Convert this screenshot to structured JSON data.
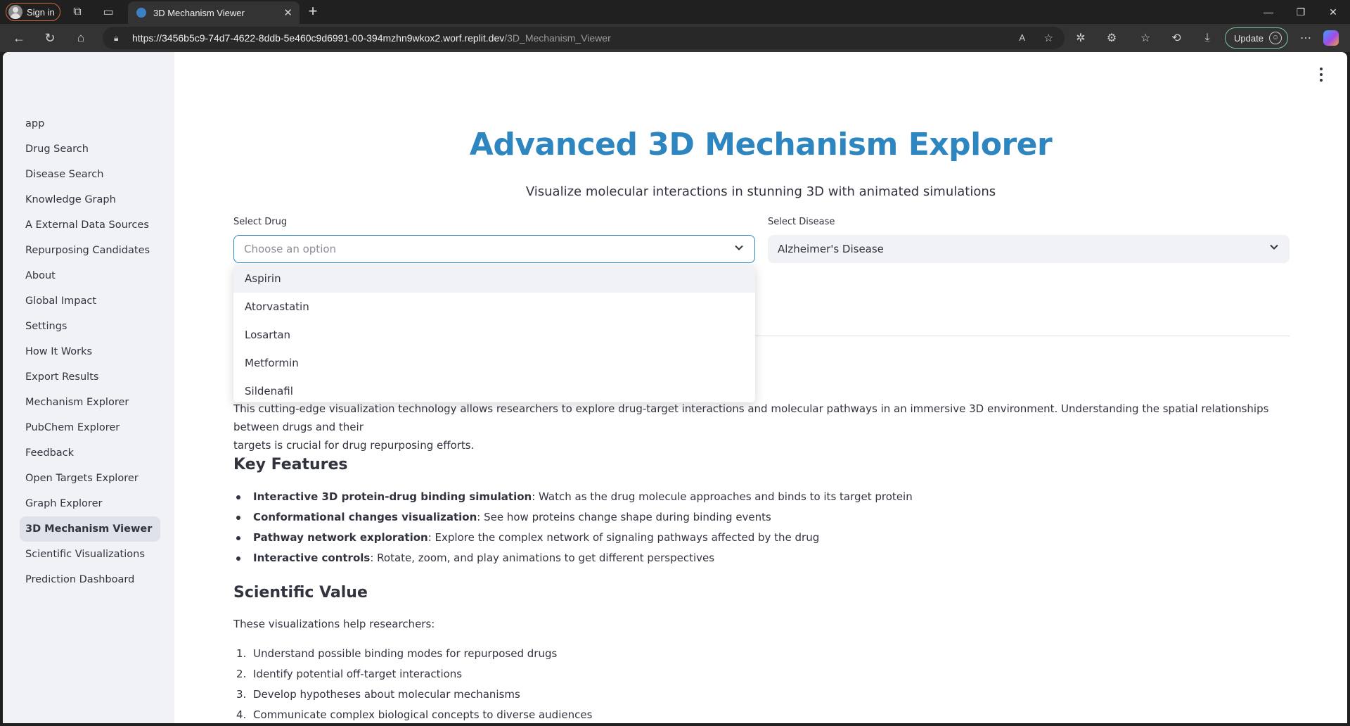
{
  "browser": {
    "signin_label": "Sign in",
    "tab_title": "3D Mechanism Viewer",
    "url_host": "https://3456b5c9-74d7-4622-8ddb-5e460c9d6991-00-394mzhn9wkox2.worf.replit.dev",
    "url_path": "/3D_Mechanism_Viewer",
    "update_label": "Update"
  },
  "sidebar": {
    "items": [
      {
        "label": "app"
      },
      {
        "label": "Drug Search"
      },
      {
        "label": "Disease Search"
      },
      {
        "label": "Knowledge Graph"
      },
      {
        "label": "A External Data Sources"
      },
      {
        "label": "Repurposing Candidates"
      },
      {
        "label": "About"
      },
      {
        "label": "Global Impact"
      },
      {
        "label": "Settings"
      },
      {
        "label": "How It Works"
      },
      {
        "label": "Export Results"
      },
      {
        "label": "Mechanism Explorer"
      },
      {
        "label": "PubChem Explorer"
      },
      {
        "label": "Feedback"
      },
      {
        "label": "Open Targets Explorer"
      },
      {
        "label": "Graph Explorer"
      },
      {
        "label": "3D Mechanism Viewer"
      },
      {
        "label": "Scientific Visualizations"
      },
      {
        "label": "Prediction Dashboard"
      }
    ],
    "active_index": 16
  },
  "header": {
    "title": "Advanced 3D Mechanism Explorer",
    "subtitle": "Visualize molecular interactions in stunning 3D with animated simulations"
  },
  "drug_select": {
    "label": "Select Drug",
    "placeholder": "Choose an option",
    "options": [
      "Aspirin",
      "Atorvastatin",
      "Losartan",
      "Metformin",
      "Sildenafil"
    ],
    "highlighted": "Aspirin"
  },
  "disease_select": {
    "label": "Select Disease",
    "value": "Alzheimer's Disease"
  },
  "content": {
    "intro_line1": "This cutting-edge visualization technology allows researchers to explore drug-target interactions and molecular pathways in an immersive 3D environment. Understanding the spatial relationships between drugs and their",
    "intro_line2": "targets is crucial for drug repurposing efforts.",
    "key_features_heading": "Key Features",
    "features": [
      {
        "bold": "Interactive 3D protein-drug binding simulation",
        "text": ": Watch as the drug molecule approaches and binds to its target protein"
      },
      {
        "bold": "Conformational changes visualization",
        "text": ": See how proteins change shape during binding events"
      },
      {
        "bold": "Pathway network exploration",
        "text": ": Explore the complex network of signaling pathways affected by the drug"
      },
      {
        "bold": "Interactive controls",
        "text": ": Rotate, zoom, and play animations to get different perspectives"
      }
    ],
    "scientific_value_heading": "Scientific Value",
    "scientific_value_intro": "These visualizations help researchers:",
    "values": [
      {
        "num": "1.",
        "text": "Understand possible binding modes for repurposed drugs"
      },
      {
        "num": "2.",
        "text": "Identify potential off-target interactions"
      },
      {
        "num": "3.",
        "text": "Develop hypotheses about molecular mechanisms"
      },
      {
        "num": "4.",
        "text": "Communicate complex biological concepts to diverse audiences"
      }
    ]
  },
  "colors": {
    "title": "#2e86c1",
    "sidebar_bg": "#f0f2f6",
    "text": "#31333f"
  }
}
